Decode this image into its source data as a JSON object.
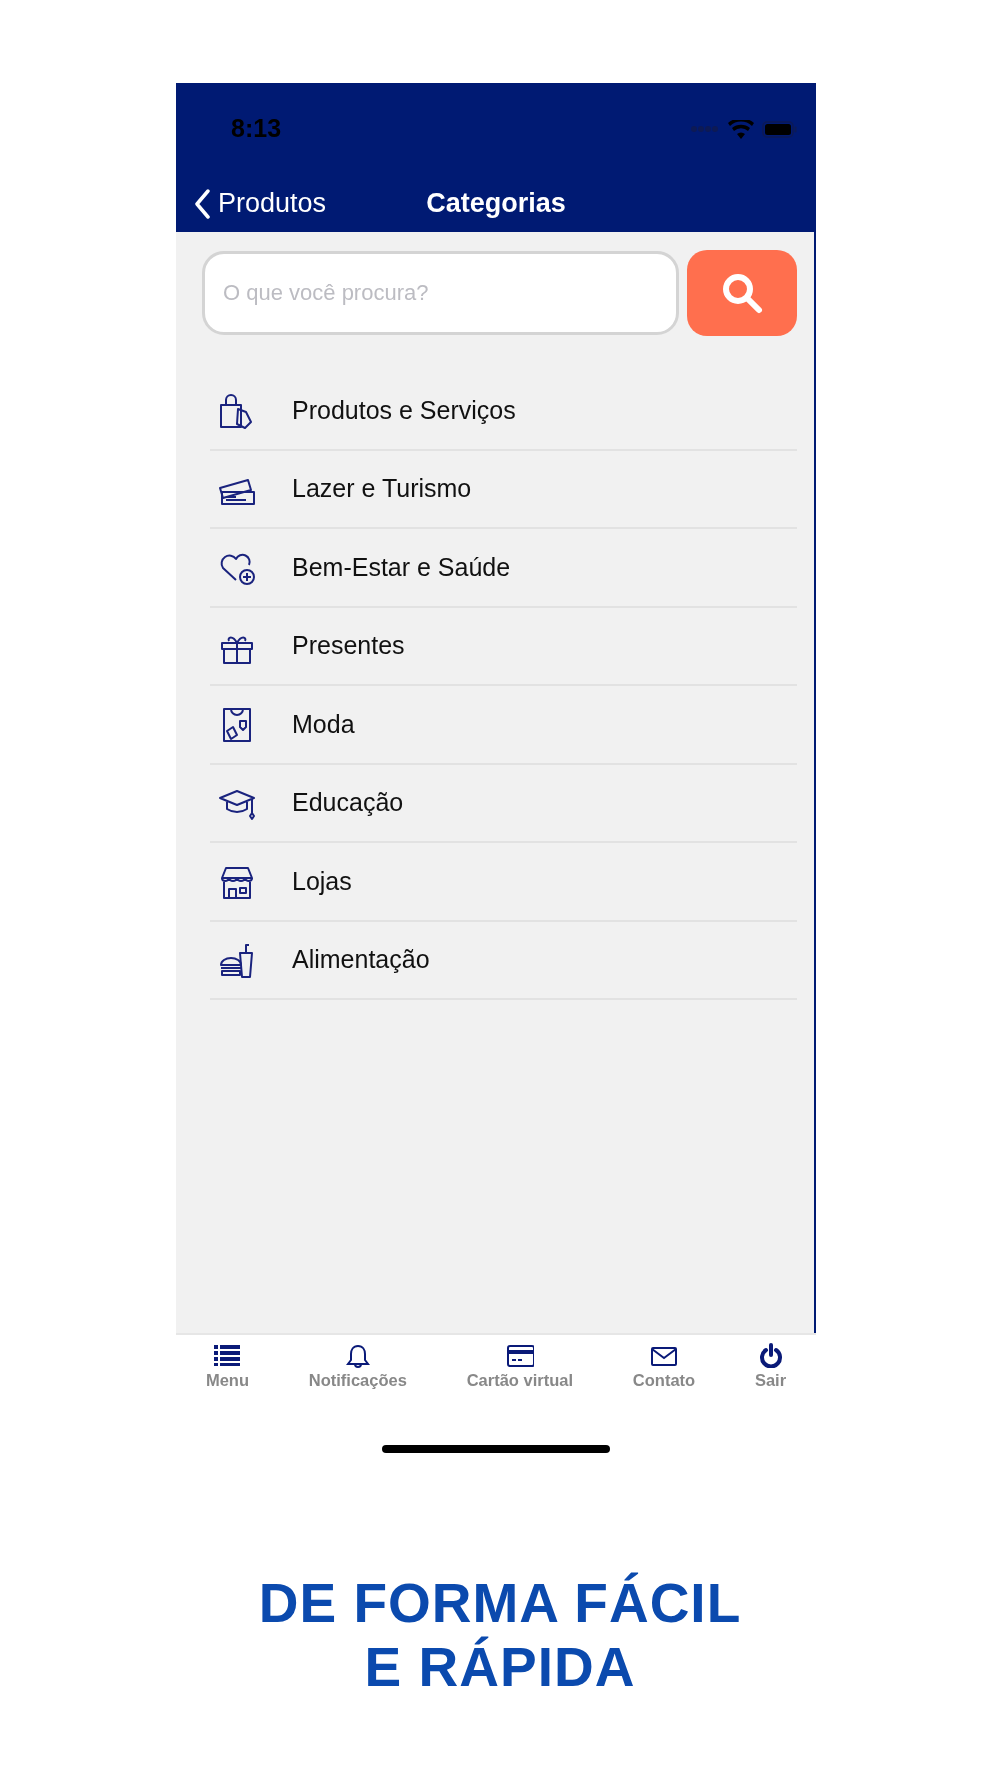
{
  "status_bar": {
    "time": "8:13"
  },
  "nav_bar": {
    "back_label": "Produtos",
    "title": "Categorias"
  },
  "search": {
    "placeholder": "O que você procura?"
  },
  "categories": [
    {
      "label": "Produtos e Serviços"
    },
    {
      "label": "Lazer e Turismo"
    },
    {
      "label": "Bem-Estar e Saúde"
    },
    {
      "label": "Presentes"
    },
    {
      "label": "Moda"
    },
    {
      "label": "Educação"
    },
    {
      "label": "Lojas"
    },
    {
      "label": "Alimentação"
    }
  ],
  "tab_bar": [
    {
      "label": "Menu"
    },
    {
      "label": "Notificações"
    },
    {
      "label": "Cartão virtual"
    },
    {
      "label": "Contato"
    },
    {
      "label": "Sair"
    }
  ],
  "caption": [
    "DE FORMA FÁCIL",
    "E RÁPIDA"
  ]
}
